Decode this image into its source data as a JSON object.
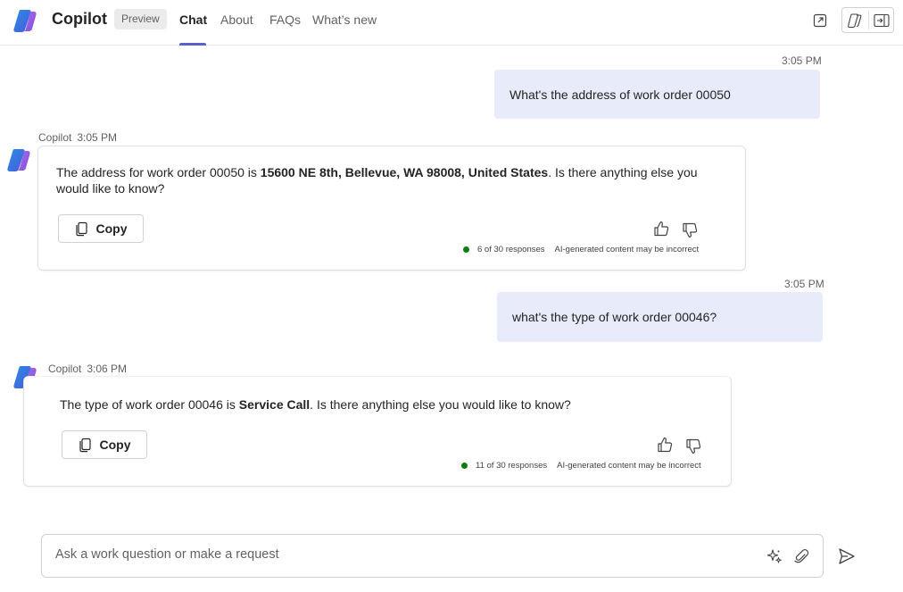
{
  "header": {
    "app_title": "Copilot",
    "preview_badge": "Preview",
    "tabs": [
      {
        "label": "Chat",
        "active": true
      },
      {
        "label": "About",
        "active": false
      },
      {
        "label": "FAQs",
        "active": false
      },
      {
        "label": "What’s new",
        "active": false
      }
    ],
    "icons": [
      "pop-out-icon",
      "copilot-toggle-icon",
      "sidebar-panel-icon"
    ]
  },
  "messages": [
    {
      "role": "user",
      "time": "3:05 PM",
      "text": "What's the address of work order 00050"
    },
    {
      "role": "bot",
      "sender": "Copilot",
      "time": "3:05 PM",
      "text_before": "The address for work order 00050 is ",
      "text_bold": "15600 NE 8th, Bellevue, WA 98008, United States",
      "text_after": ". Is there anything else you would like to know?",
      "copy_label": "Copy",
      "responses": "6 of 30 responses",
      "disclaimer": "AI-generated content may be incorrect"
    },
    {
      "role": "user",
      "time": "3:05 PM",
      "text": "what's the type of work order 00046?"
    },
    {
      "role": "bot",
      "sender": "Copilot",
      "time": "3:06 PM",
      "text_before": "The type of work order 00046 is ",
      "text_bold": "Service Call",
      "text_after": ". Is there anything else you would like to know?",
      "copy_label": "Copy",
      "responses": "11 of 30 responses",
      "disclaimer": "AI-generated content may be incorrect"
    }
  ],
  "composer": {
    "placeholder": "Ask a work question or make a request",
    "icons": [
      "sparkle-prompts-icon",
      "attach-icon",
      "send-icon"
    ]
  },
  "colors": {
    "accent": "#5b5fc7",
    "user_bubble": "#e8ebfa",
    "status_dot": "#107c10"
  }
}
